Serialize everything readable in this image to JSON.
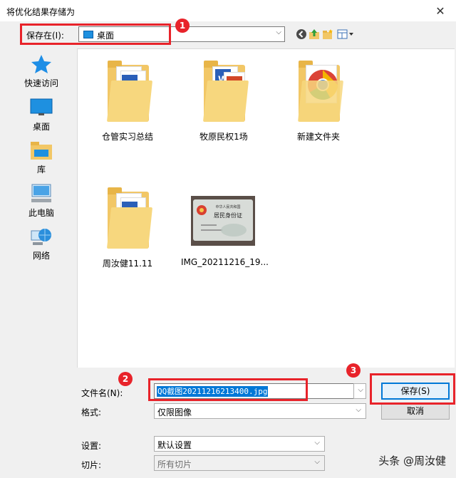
{
  "window": {
    "title": "将优化结果存储为",
    "close_glyph": "✕"
  },
  "toolbar": {
    "save_in_label": "保存在(I):",
    "location_value": "桌面"
  },
  "sidebar": {
    "items": [
      {
        "label": "快速访问",
        "icon": "star-icon"
      },
      {
        "label": "桌面",
        "icon": "desktop-icon"
      },
      {
        "label": "库",
        "icon": "library-icon"
      },
      {
        "label": "此电脑",
        "icon": "computer-icon"
      },
      {
        "label": "网络",
        "icon": "network-icon"
      }
    ]
  },
  "files": [
    {
      "name": "仓管实习总结",
      "type": "folder-word"
    },
    {
      "name": "牧原民权1场",
      "type": "folder-word-ppt"
    },
    {
      "name": "新建文件夹",
      "type": "folder-chrome"
    },
    {
      "name": "周汝健11.11",
      "type": "folder-word"
    },
    {
      "name": "IMG_20211216_19...",
      "type": "image-idcard",
      "thumb_text": "中华人民共和国",
      "thumb_title": "居民身份证"
    }
  ],
  "form": {
    "filename_label": "文件名(N):",
    "filename_value": "QQ截图20211216213400.jpg",
    "format_label": "格式:",
    "format_value": "仅限图像",
    "settings_label": "设置:",
    "settings_value": "默认设置",
    "slices_label": "切片:",
    "slices_value": "所有切片",
    "save_button": "保存(S)",
    "cancel_button": "取消"
  },
  "annotations": [
    "1",
    "2",
    "3"
  ],
  "watermark": "头条 @周汝健",
  "colors": {
    "annotation_red": "#e8232a",
    "selection_blue": "#0078d7",
    "folder_yellow": "#f2c766"
  }
}
